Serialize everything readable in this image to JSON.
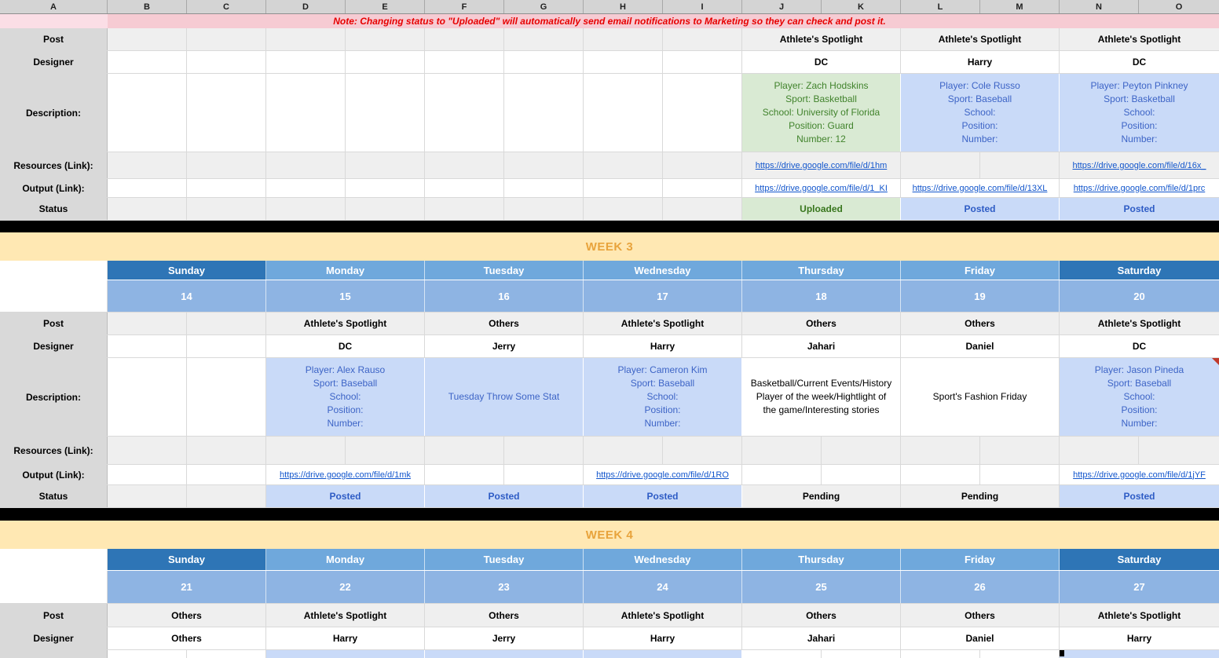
{
  "note": "Note: Changing status to \"Uploaded\" will automatically send email notifications to Marketing so they can check and post it.",
  "column_headers": [
    "A",
    "B",
    "C",
    "D",
    "E",
    "F",
    "G",
    "H",
    "I",
    "J",
    "K",
    "L",
    "M",
    "N",
    "O"
  ],
  "row_labels": {
    "post": "Post",
    "designer": "Designer",
    "description": "Description:",
    "resources": "Resources (Link):",
    "output": "Output (Link):",
    "status": "Status"
  },
  "sections": {
    "week2": {
      "days": [
        {},
        {},
        {},
        {},
        {
          "post": "Athlete's Spotlight",
          "designer": "DC",
          "desc": {
            "style": "green",
            "lines": [
              "Player: Zach Hodskins",
              "Sport: Basketball",
              "School: University of Florida",
              "Position: Guard",
              "Number: 12"
            ]
          },
          "resources": {
            "text": "https://drive.google.com/file/d/1hm"
          },
          "output": {
            "text": "https://drive.google.com/file/d/1_KI"
          },
          "status": {
            "text": "Uploaded",
            "style": "green"
          }
        },
        {
          "post": "Athlete's Spotlight",
          "designer": "Harry",
          "desc": {
            "style": "blue",
            "lines": [
              "Player: Cole Russo",
              "Sport: Baseball",
              "School:",
              "Position:",
              "Number:"
            ]
          },
          "output": {
            "text": "https://drive.google.com/file/d/13XL"
          },
          "status": {
            "text": "Posted",
            "style": "blue"
          }
        },
        {
          "post": "Athlete's Spotlight",
          "designer": "DC",
          "desc": {
            "style": "blue",
            "lines": [
              "Player: Peyton Pinkney",
              "Sport: Basketball",
              "School:",
              "Position:",
              "Number:"
            ]
          },
          "resources": {
            "text": "https://drive.google.com/file/d/16x_"
          },
          "output": {
            "text": "https://drive.google.com/file/d/1prc"
          },
          "status": {
            "text": "Posted",
            "style": "blue"
          }
        }
      ]
    },
    "week3": {
      "title": "WEEK 3",
      "day_names": [
        "Sunday",
        "Monday",
        "Tuesday",
        "Wednesday",
        "Thursday",
        "Friday",
        "Saturday"
      ],
      "dates": [
        "14",
        "15",
        "16",
        "17",
        "18",
        "19",
        "20"
      ],
      "days": [
        {},
        {
          "post": "Athlete's Spotlight",
          "designer": "DC",
          "desc": {
            "style": "blue",
            "lines": [
              "Player: Alex Rauso",
              "Sport: Baseball",
              "School:",
              "Position:",
              "Number:"
            ]
          },
          "output": {
            "text": "https://drive.google.com/file/d/1mk"
          },
          "status": {
            "text": "Posted",
            "style": "blue"
          }
        },
        {
          "post": "Others",
          "designer": "Jerry",
          "desc": {
            "style": "blue",
            "lines": [
              "Tuesday Throw Some Stat"
            ]
          },
          "status": {
            "text": "Posted",
            "style": "blue"
          }
        },
        {
          "post": "Athlete's Spotlight",
          "designer": "Harry",
          "desc": {
            "style": "blue",
            "lines": [
              "Player: Cameron Kim",
              "Sport: Baseball",
              "School:",
              "Position:",
              "Number:"
            ]
          },
          "output": {
            "text": "https://drive.google.com/file/d/1RO"
          },
          "status": {
            "text": "Posted",
            "style": "blue"
          }
        },
        {
          "post": "Others",
          "designer": "Jahari",
          "desc": {
            "style": "plain",
            "lines": [
              "Basketball/Current Events/History",
              "Player of the week/Hightlight of",
              "the game/Interesting stories"
            ]
          },
          "status": {
            "text": "Pending",
            "style": "plain"
          }
        },
        {
          "post": "Others",
          "designer": "Daniel",
          "desc": {
            "style": "plain",
            "lines": [
              "Sport's Fashion Friday"
            ]
          },
          "status": {
            "text": "Pending",
            "style": "plain"
          }
        },
        {
          "post": "Athlete's Spotlight",
          "designer": "DC",
          "desc": {
            "style": "blue",
            "comment": true,
            "lines": [
              "Player: Jason Pineda",
              "Sport: Baseball",
              "School:",
              "Position:",
              "Number:"
            ]
          },
          "output": {
            "text": "https://drive.google.com/file/d/1jYF"
          },
          "status": {
            "text": "Posted",
            "style": "blue"
          }
        }
      ]
    },
    "week4": {
      "title": "WEEK 4",
      "day_names": [
        "Sunday",
        "Monday",
        "Tuesday",
        "Wednesday",
        "Thursday",
        "Friday",
        "Saturday"
      ],
      "dates": [
        "21",
        "22",
        "23",
        "24",
        "25",
        "26",
        "27"
      ],
      "days": [
        {
          "post": "Others",
          "designer": "Others",
          "desc_style": "plain"
        },
        {
          "post": "Athlete's Spotlight",
          "designer": "Harry",
          "desc_style": "blue"
        },
        {
          "post": "Others",
          "designer": "Jerry",
          "desc_style": "blue"
        },
        {
          "post": "Athlete's Spotlight",
          "designer": "Harry",
          "desc_style": "blue"
        },
        {
          "post": "Others",
          "designer": "Jahari",
          "desc_style": "plain"
        },
        {
          "post": "Others",
          "designer": "Daniel",
          "desc_style": "plain"
        },
        {
          "post": "Athlete's Spotlight",
          "designer": "Harry",
          "desc_style": "blue"
        }
      ]
    }
  },
  "colors": {
    "note_bg": "#F6CBD3",
    "note_text": "#E60000",
    "header_bg": "#D4D4D4",
    "label_bg": "#D9D9D9",
    "row_gray": "#EFEFEF",
    "banner_bg": "#FFE8B3",
    "banner_text": "#E8A33C",
    "day_dark": "#2E75B6",
    "day_mid": "#6FA8DC",
    "date_bg": "#8EB4E3",
    "desc_green_bg": "#D9EAD3",
    "desc_green_text": "#41832C",
    "desc_blue_bg": "#C9DAF8",
    "desc_blue_text": "#3D64C6",
    "status_green_text": "#38761D",
    "status_blue_text": "#2E5CC5",
    "link": "#1155CC",
    "grid": "#D9D9D9",
    "separator": "#000000",
    "marker": "#C0392B"
  }
}
